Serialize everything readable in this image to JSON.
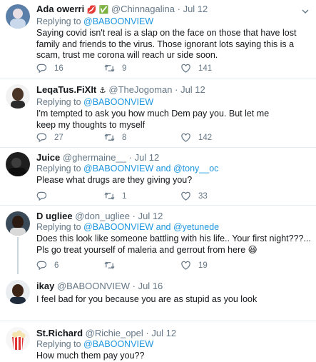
{
  "tweets": [
    {
      "name": "Ada owerri",
      "badge": "💋 ✅",
      "handle": "@Chinnagalina",
      "time": "Jul 12",
      "replying_prefix": "Replying to",
      "replying_to": "@BABOONVIEW",
      "replying_and": "",
      "replying_to2": "",
      "text": "Saying covid isn't real is a slap on the face on those that have lost family and friends to the virus. Those ignorant lots saying this is a scam, trust me corona will reach ur side soon.",
      "replies": "16",
      "retweets": "9",
      "likes": "141"
    },
    {
      "name": "LeqaTus.FiXIt",
      "badge": "⚓",
      "handle": "@TheJogoman",
      "time": "Jul 12",
      "replying_prefix": "Replying to",
      "replying_to": "@BABOONVIEW",
      "replying_and": "",
      "replying_to2": "",
      "text": "I'm tempted to ask you how much Dem pay you. But let me keep my thoughts to myself",
      "replies": "27",
      "retweets": "8",
      "likes": "142"
    },
    {
      "name": "Juice",
      "badge": "",
      "handle": "@ghermaine__",
      "time": "Jul 12",
      "replying_prefix": "Replying to",
      "replying_to": "@BABOONVIEW",
      "replying_and": "and",
      "replying_to2": "@tony__oc",
      "text": "Please what drugs are they giving you?",
      "replies": "",
      "retweets": "1",
      "likes": "33"
    },
    {
      "name": "D ugliee",
      "badge": "",
      "handle": "@don_ugliee",
      "time": "Jul 12",
      "replying_prefix": "Replying to",
      "replying_to": "@BABOONVIEW",
      "replying_and": "and",
      "replying_to2": "@yetunede",
      "text": "Does this look like someone battling with his life.. Your first night???... Pls go treat yourself of maleria and gerrout from here 😆",
      "replies": "6",
      "retweets": "",
      "likes": "19"
    },
    {
      "name": "ikay",
      "badge": "",
      "handle": "@BABOONVIEW",
      "time": "Jul 16",
      "text": "I feel bad for you because you are as stupid as you look"
    },
    {
      "name": "St.Richard",
      "badge": "",
      "handle": "@Richie_opel",
      "time": "Jul 12",
      "replying_prefix": "Replying to",
      "replying_to": "@BABOONVIEW",
      "text": "How much them pay you??"
    }
  ],
  "colors": {
    "accent": "#1b95e0",
    "muted": "#657786",
    "border": "#e6ecf0"
  },
  "icons": [
    "reply-icon",
    "retweet-icon",
    "like-icon",
    "caret-down-icon"
  ]
}
